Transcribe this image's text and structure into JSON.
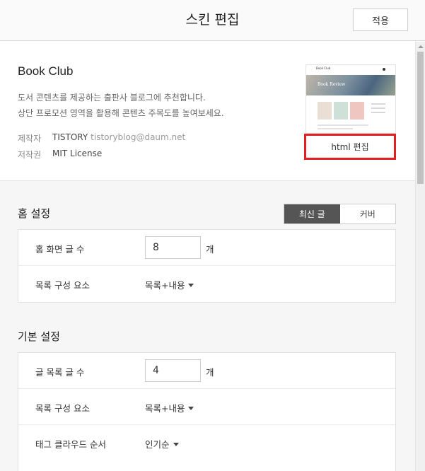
{
  "header": {
    "title": "스킨 편집",
    "apply_label": "적용"
  },
  "skin": {
    "name": "Book Club",
    "description_line1": "도서 콘텐츠를 제공하는 출판사 블로그에 추천합니다.",
    "description_line2": "상단 프로모션 영역을 활용해 콘텐츠 주목도를 높여보세요.",
    "maker_label": "제작자",
    "maker_name": "TISTORY",
    "maker_email": "tistoryblog@daum.net",
    "license_label": "저작권",
    "license_value": "MIT License",
    "html_edit_label": "html 편집",
    "thumbnail": {
      "logo": "Book Club",
      "hero_text": "Book Review"
    }
  },
  "home_settings": {
    "title": "홈 설정",
    "toggle": {
      "options": [
        "최신 글",
        "커버"
      ],
      "selected": "최신 글"
    },
    "rows": [
      {
        "label": "홈 화면 글 수",
        "value": "8",
        "unit": "개"
      },
      {
        "label": "목록 구성 요소",
        "selected": "목록+내용"
      }
    ]
  },
  "basic_settings": {
    "title": "기본 설정",
    "rows": [
      {
        "label": "글 목록 글 수",
        "value": "4",
        "unit": "개"
      },
      {
        "label": "목록 구성 요소",
        "selected": "목록+내용"
      },
      {
        "label": "태그 클라우드 순서",
        "selected": "인기순"
      }
    ]
  },
  "colors": {
    "highlight": "#e02020",
    "active_toggle": "#555555"
  }
}
